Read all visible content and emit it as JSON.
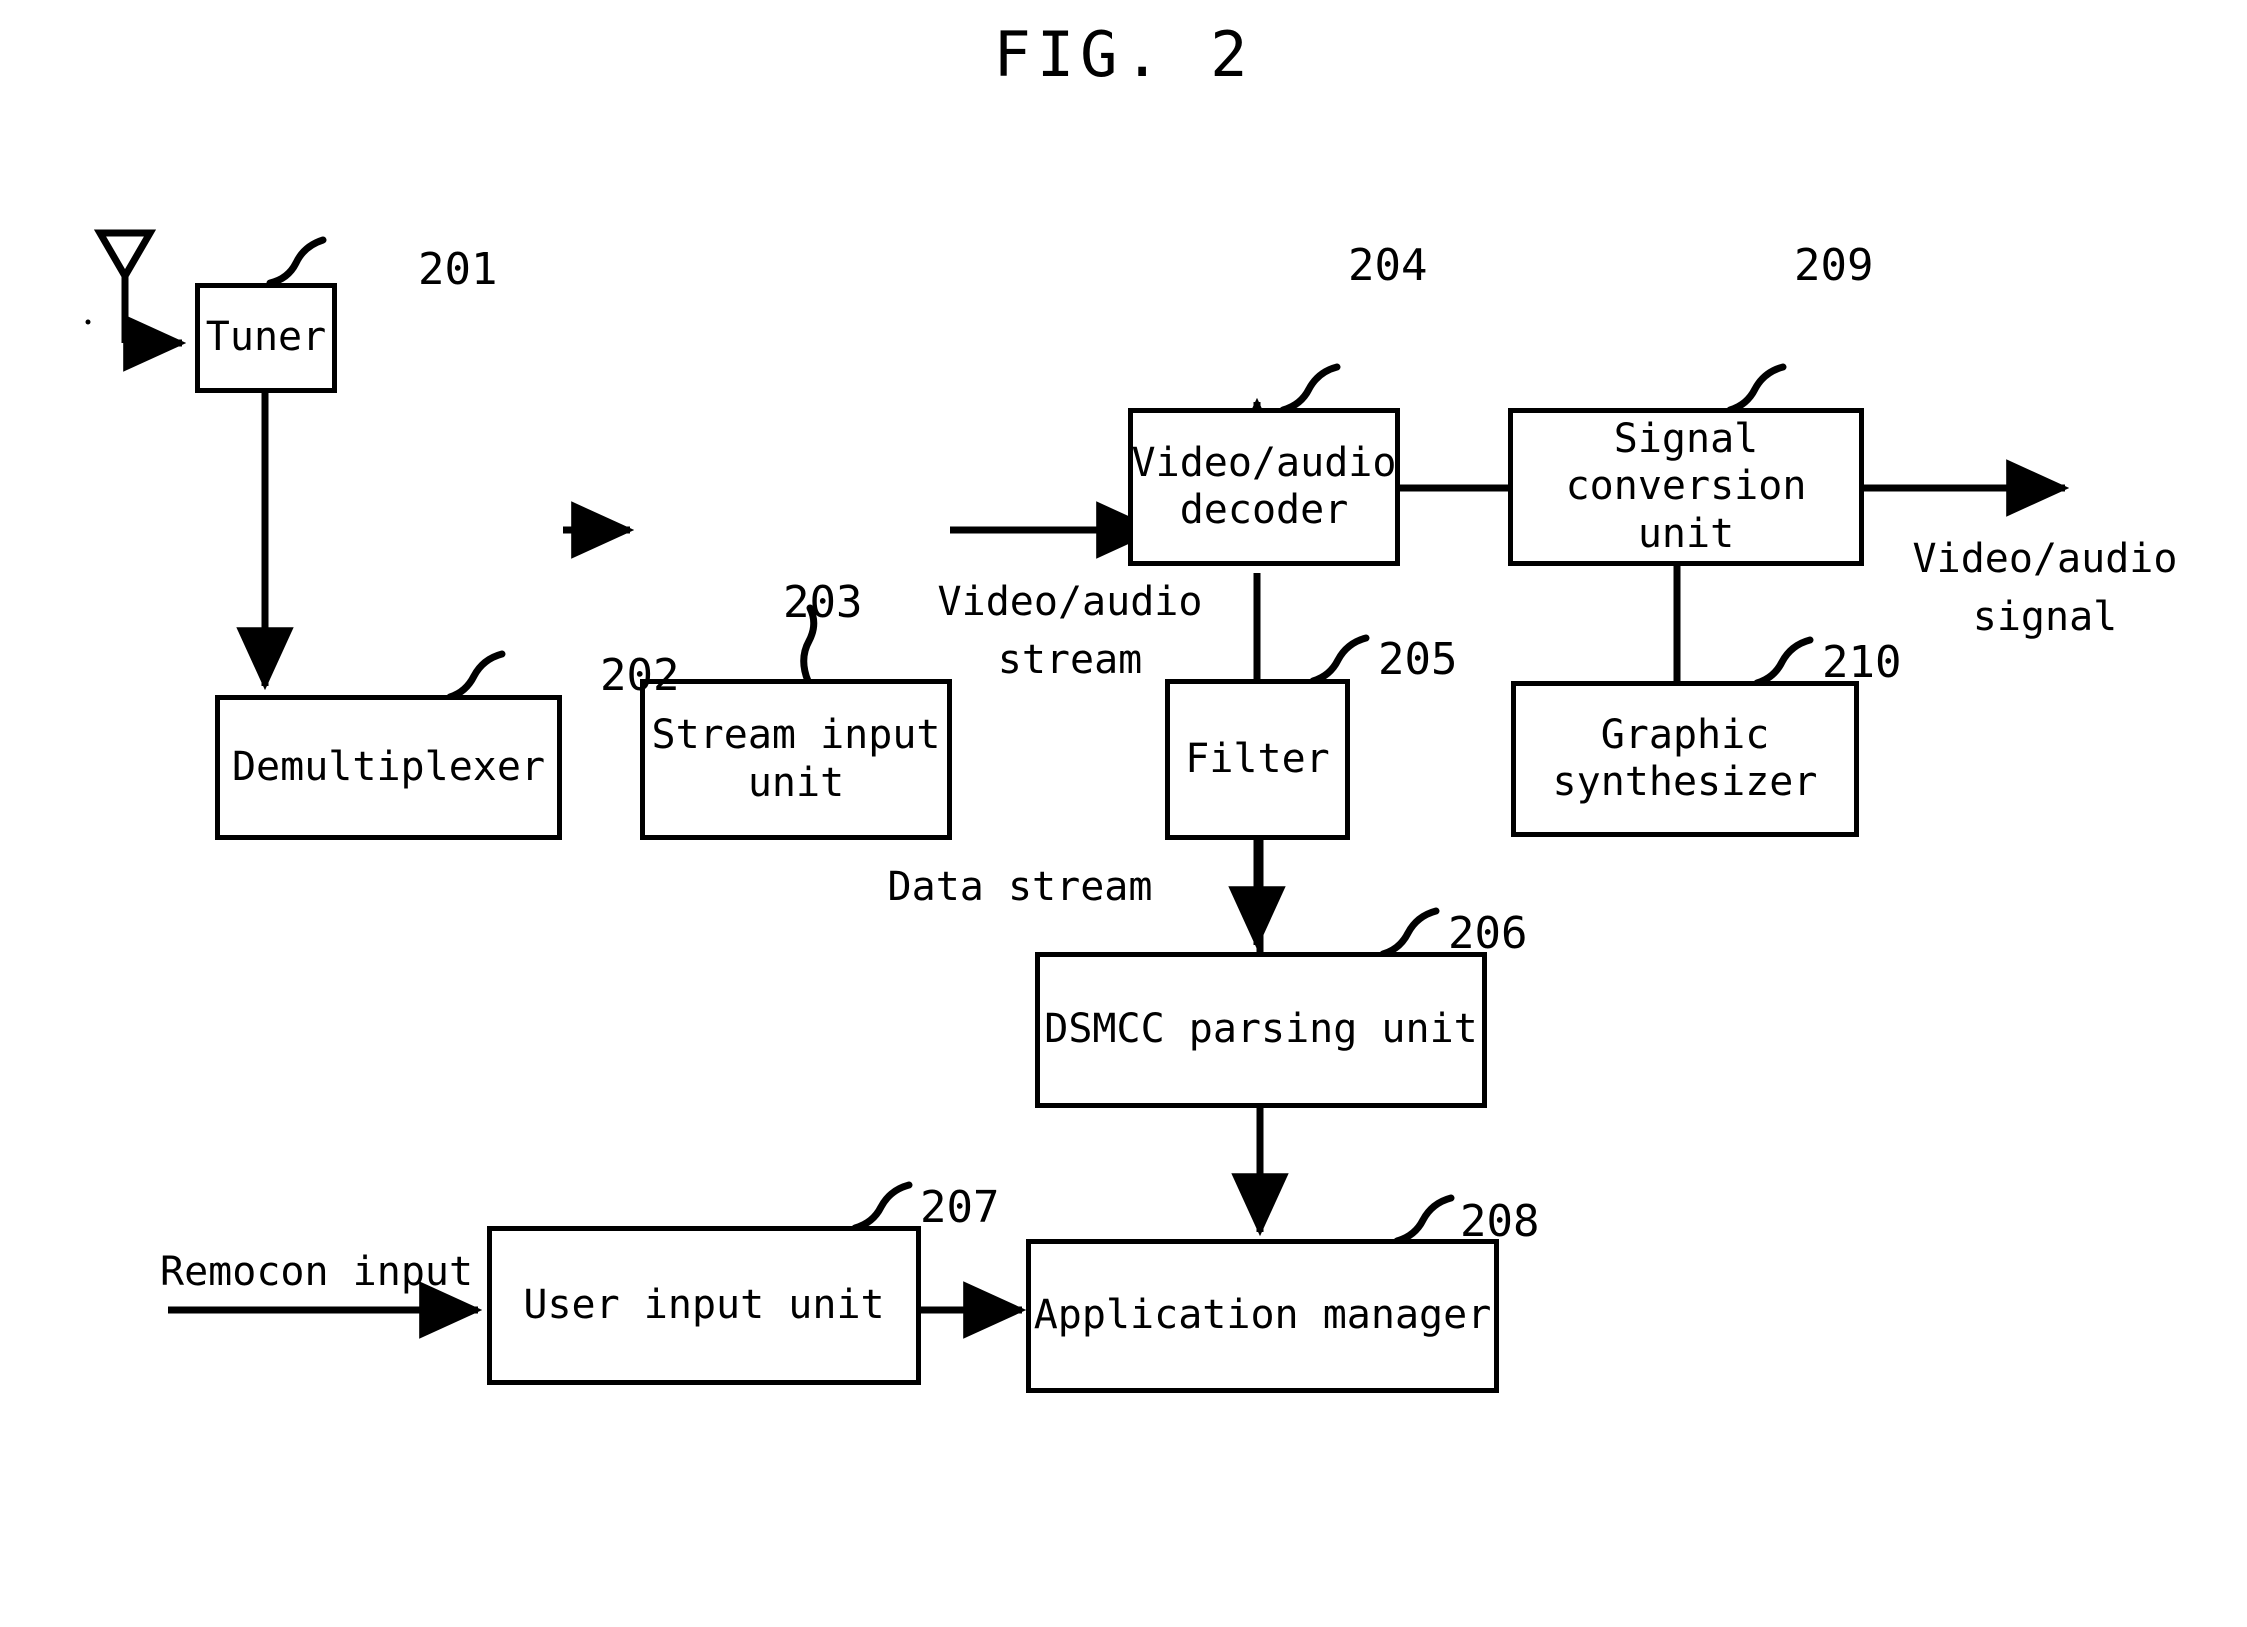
{
  "figure": {
    "title": "FIG. 2"
  },
  "blocks": [
    {
      "id": "tuner",
      "label": "Tuner",
      "ref": "201"
    },
    {
      "id": "demultiplexer",
      "label": "Demultiplexer",
      "ref": "202"
    },
    {
      "id": "stream-input-unit",
      "label": "Stream input unit",
      "ref": "203"
    },
    {
      "id": "video-audio-decoder",
      "label": "Video/audio\ndecoder",
      "ref": "204"
    },
    {
      "id": "filter",
      "label": "Filter",
      "ref": "205"
    },
    {
      "id": "dsmcc-parsing-unit",
      "label": "DSMCC parsing unit",
      "ref": "206"
    },
    {
      "id": "user-input-unit",
      "label": "User input unit",
      "ref": "207"
    },
    {
      "id": "application-manager",
      "label": "Application manager",
      "ref": "208"
    },
    {
      "id": "signal-conversion-unit",
      "label": "Signal\nconversion unit",
      "ref": "209"
    },
    {
      "id": "graphic-synthesizer",
      "label": "Graphic\nsynthesizer",
      "ref": "210"
    }
  ],
  "flow_labels": {
    "video_audio_stream": "Video/audio\nstream",
    "data_stream": "Data stream",
    "video_audio_signal": "Video/audio\nsignal",
    "remocon_input": "Remocon input"
  },
  "icons": {
    "antenna": "antenna-icon"
  },
  "colors": {
    "line": "#000000",
    "background": "#ffffff"
  }
}
